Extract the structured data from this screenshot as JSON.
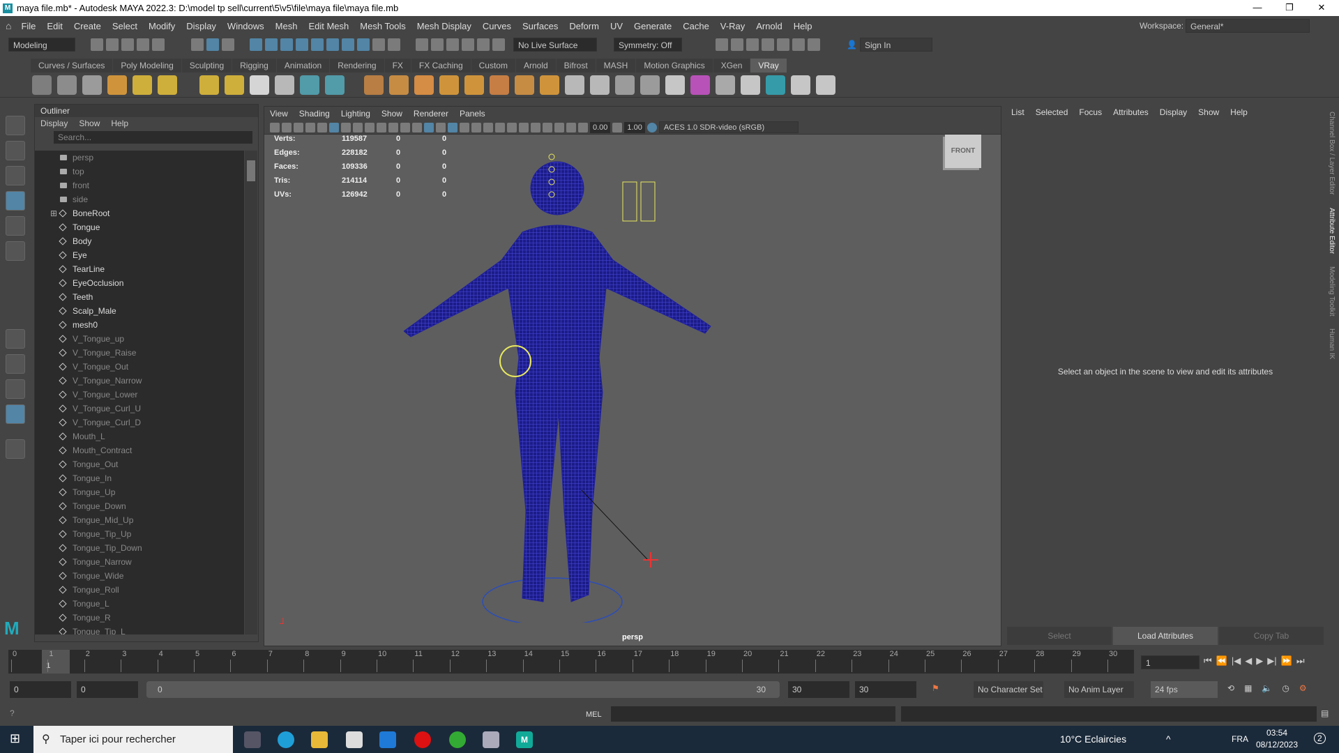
{
  "window": {
    "title": "maya file.mb* - Autodesk MAYA 2022.3: D:\\model tp sell\\current\\5\\v5\\file\\maya file\\maya file.mb",
    "minimize": "—",
    "maximize": "❐",
    "close": "✕"
  },
  "menubar": [
    "File",
    "Edit",
    "Create",
    "Select",
    "Modify",
    "Display",
    "Windows",
    "Mesh",
    "Edit Mesh",
    "Mesh Tools",
    "Mesh Display",
    "Curves",
    "Surfaces",
    "Deform",
    "UV",
    "Generate",
    "Cache",
    "V-Ray",
    "Arnold",
    "Help"
  ],
  "status": {
    "mode": "Modeling",
    "live_surface": "No Live Surface",
    "symmetry": "Symmetry: Off",
    "sign_in": "Sign In",
    "workspace_label": "Workspace:",
    "workspace": "General*"
  },
  "shelf_tabs": [
    "Curves / Surfaces",
    "Poly Modeling",
    "Sculpting",
    "Rigging",
    "Animation",
    "Rendering",
    "FX",
    "FX Caching",
    "Custom",
    "Arnold",
    "Bifrost",
    "MASH",
    "Motion Graphics",
    "XGen",
    "VRay"
  ],
  "shelf_active": "VRay",
  "outliner": {
    "title": "Outliner",
    "menu": [
      "Display",
      "Show",
      "Help"
    ],
    "search_placeholder": "Search...",
    "items": [
      {
        "label": "persp",
        "type": "cam",
        "dim": true
      },
      {
        "label": "top",
        "type": "cam",
        "dim": true
      },
      {
        "label": "front",
        "type": "cam",
        "dim": true
      },
      {
        "label": "side",
        "type": "cam",
        "dim": true
      },
      {
        "label": "BoneRoot",
        "type": "joint"
      },
      {
        "label": "Tongue",
        "type": "mesh"
      },
      {
        "label": "Body",
        "type": "mesh"
      },
      {
        "label": "Eye",
        "type": "mesh"
      },
      {
        "label": "TearLine",
        "type": "mesh"
      },
      {
        "label": "EyeOcclusion",
        "type": "mesh"
      },
      {
        "label": "Teeth",
        "type": "mesh"
      },
      {
        "label": "Scalp_Male",
        "type": "mesh"
      },
      {
        "label": "mesh0",
        "type": "mesh"
      },
      {
        "label": "V_Tongue_up",
        "type": "mesh",
        "dim": true
      },
      {
        "label": "V_Tongue_Raise",
        "type": "mesh",
        "dim": true
      },
      {
        "label": "V_Tongue_Out",
        "type": "mesh",
        "dim": true
      },
      {
        "label": "V_Tongue_Narrow",
        "type": "mesh",
        "dim": true
      },
      {
        "label": "V_Tongue_Lower",
        "type": "mesh",
        "dim": true
      },
      {
        "label": "V_Tongue_Curl_U",
        "type": "mesh",
        "dim": true
      },
      {
        "label": "V_Tongue_Curl_D",
        "type": "mesh",
        "dim": true
      },
      {
        "label": "Mouth_L",
        "type": "mesh",
        "dim": true
      },
      {
        "label": "Mouth_Contract",
        "type": "mesh",
        "dim": true
      },
      {
        "label": "Tongue_Out",
        "type": "mesh",
        "dim": true
      },
      {
        "label": "Tongue_In",
        "type": "mesh",
        "dim": true
      },
      {
        "label": "Tongue_Up",
        "type": "mesh",
        "dim": true
      },
      {
        "label": "Tongue_Down",
        "type": "mesh",
        "dim": true
      },
      {
        "label": "Tongue_Mid_Up",
        "type": "mesh",
        "dim": true
      },
      {
        "label": "Tongue_Tip_Up",
        "type": "mesh",
        "dim": true
      },
      {
        "label": "Tongue_Tip_Down",
        "type": "mesh",
        "dim": true
      },
      {
        "label": "Tongue_Narrow",
        "type": "mesh",
        "dim": true
      },
      {
        "label": "Tongue_Wide",
        "type": "mesh",
        "dim": true
      },
      {
        "label": "Tongue_Roll",
        "type": "mesh",
        "dim": true
      },
      {
        "label": "Tongue_L",
        "type": "mesh",
        "dim": true
      },
      {
        "label": "Tongue_R",
        "type": "mesh",
        "dim": true
      },
      {
        "label": "Tongue_Tip_L",
        "type": "mesh",
        "dim": true
      }
    ]
  },
  "viewport": {
    "menu": [
      "View",
      "Shading",
      "Lighting",
      "Show",
      "Renderer",
      "Panels"
    ],
    "exposure": "0.00",
    "gamma": "1.00",
    "color_space": "ACES 1.0 SDR-video (sRGB)",
    "camera": "persp",
    "view_cube": "FRONT",
    "hud": [
      {
        "label": "Verts:",
        "v": [
          "119587",
          "0",
          "0"
        ]
      },
      {
        "label": "Edges:",
        "v": [
          "228182",
          "0",
          "0"
        ]
      },
      {
        "label": "Faces:",
        "v": [
          "109336",
          "0",
          "0"
        ]
      },
      {
        "label": "Tris:",
        "v": [
          "214114",
          "0",
          "0"
        ]
      },
      {
        "label": "UVs:",
        "v": [
          "126942",
          "0",
          "0"
        ]
      }
    ]
  },
  "attribute_editor": {
    "menu": [
      "List",
      "Selected",
      "Focus",
      "Attributes",
      "Display",
      "Show",
      "Help"
    ],
    "message": "Select an object in the scene to view and edit its attributes",
    "buttons": [
      "Select",
      "Load Attributes",
      "Copy Tab"
    ]
  },
  "right_tabs": [
    "Channel Box / Layer Editor",
    "Attribute Editor",
    "Modeling Toolkit",
    "Human IK"
  ],
  "timeline": {
    "ticks": [
      "0",
      "1",
      "2",
      "3",
      "4",
      "5",
      "6",
      "7",
      "8",
      "9",
      "10",
      "11",
      "12",
      "13",
      "14",
      "15",
      "16",
      "17",
      "18",
      "19",
      "20",
      "21",
      "22",
      "23",
      "24",
      "25",
      "26",
      "27",
      "28",
      "29",
      "30"
    ],
    "current_frame": "1",
    "current_marker": "1"
  },
  "range": {
    "start": "0",
    "anim_start": "0",
    "slider_start": "0",
    "slider_end": "30",
    "anim_end": "30",
    "end": "30",
    "character_set": "No Character Set",
    "anim_layer": "No Anim Layer",
    "fps": "24 fps"
  },
  "command": {
    "lang": "MEL"
  },
  "taskbar": {
    "search": "Taper ici pour rechercher",
    "weather": "10°C  Eclaircies",
    "lang": "FRA",
    "time": "03:54",
    "date": "08/12/2023",
    "notif": "2"
  }
}
